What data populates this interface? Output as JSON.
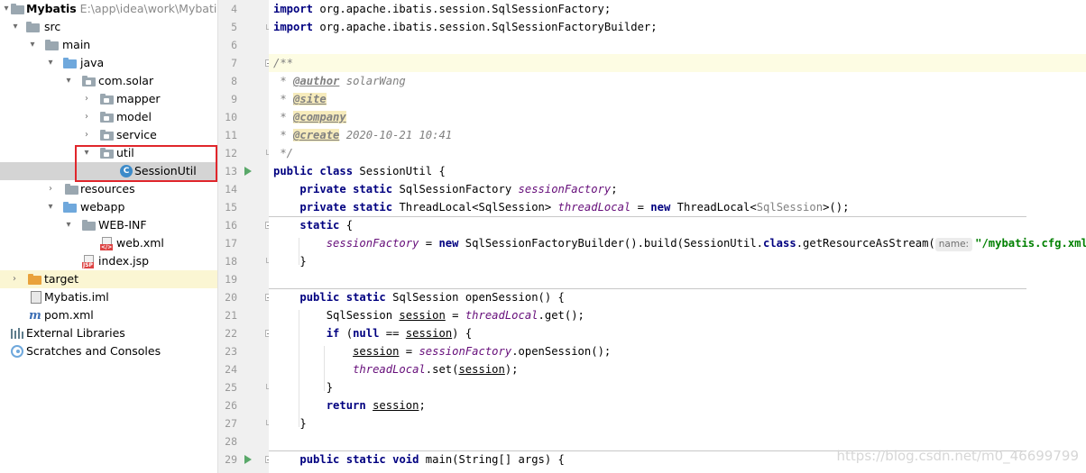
{
  "project_tree": {
    "root": {
      "name": "Mybatis",
      "path": "E:\\app\\idea\\work\\Mybatis"
    },
    "items": [
      {
        "label": "src"
      },
      {
        "label": "main"
      },
      {
        "label": "java"
      },
      {
        "label": "com.solar"
      },
      {
        "label": "mapper"
      },
      {
        "label": "model"
      },
      {
        "label": "service"
      },
      {
        "label": "util"
      },
      {
        "label": "SessionUtil"
      },
      {
        "label": "resources"
      },
      {
        "label": "webapp"
      },
      {
        "label": "WEB-INF"
      },
      {
        "label": "web.xml"
      },
      {
        "label": "index.jsp"
      },
      {
        "label": "target"
      },
      {
        "label": "Mybatis.iml"
      },
      {
        "label": "pom.xml"
      },
      {
        "label": "External Libraries"
      },
      {
        "label": "Scratches and Consoles"
      }
    ],
    "highlight_color": "#e0262b"
  },
  "editor": {
    "line_numbers": [
      "4",
      "5",
      "6",
      "7",
      "8",
      "9",
      "10",
      "11",
      "12",
      "13",
      "14",
      "15",
      "16",
      "17",
      "18",
      "19",
      "20",
      "21",
      "22",
      "23",
      "24",
      "25",
      "26",
      "27",
      "28",
      "29"
    ],
    "tokens": {
      "import": "import",
      "import_1_path": " org.apache.ibatis.session.SqlSessionFactory;",
      "import_2_path": " org.apache.ibatis.session.SqlSessionFactoryBuilder;",
      "doc_open": "/**",
      "doc_star": " * ",
      "doc_close": " */",
      "tag_author": "@author",
      "author_value": " solarWang",
      "tag_site": "@site",
      "tag_company": "@company",
      "tag_create": "@create",
      "create_value": " 2020-10-21 10:41",
      "public": "public",
      "private": "private",
      "static": "static",
      "class": "class",
      "new": "new",
      "if": "if",
      "null": "null",
      "return": "return",
      "void": "void",
      "sp": " ",
      "class_name": " SessionUtil {",
      "factory_type": " SqlSessionFactory ",
      "field_factory": "sessionFactory",
      "semi": ";",
      "threadlocal_type": " ThreadLocal<SqlSession> ",
      "field_threadlocal": "threadLocal",
      "assign_eq": " = ",
      "new_threadlocal": " ThreadLocal<",
      "generic_arg": "SqlSession",
      "new_tail": ">();",
      "static_open": " {",
      "builder_call": " SqlSessionFactoryBuilder().build(SessionUtil.",
      "get_resource": ".getResourceAsStream(",
      "param_hint": "name:",
      "config_path": "\"/mybatis.cfg.xml\"",
      "close_call": "));",
      "close_brace": "}",
      "open_session_sig": " SqlSession openSession() {",
      "sqlsession_decl": "SqlSession ",
      "var_session": "session",
      "get_call": ".get();",
      "if_open": " (",
      "eq_eq": " == ",
      "if_close": ") {",
      "open_session_call": ".openSession();",
      "set_open": ".set(",
      "set_close": ");",
      "main_sig": " main(String[] args) {"
    }
  },
  "watermark": "https://blog.csdn.net/m0_46699799"
}
